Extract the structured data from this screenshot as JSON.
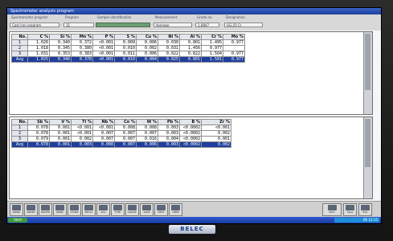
{
  "window": {
    "title": "Spectrometer analysis program"
  },
  "infobar": [
    {
      "text": "Spectrometer program",
      "kind": "lab"
    },
    {
      "text": "Program",
      "kind": "lab"
    },
    {
      "text": "Sample identification",
      "kind": "lab"
    },
    {
      "text": "Measurement",
      "kind": "lab"
    },
    {
      "text": "Grade no.",
      "kind": "lab"
    },
    {
      "text": "Designation",
      "kind": "lab"
    },
    {
      "text": "Cast iron program",
      "kind": "box"
    },
    {
      "text": "11",
      "kind": "box"
    },
    {
      "text": "",
      "kind": "green"
    },
    {
      "text": "Average",
      "kind": "box"
    },
    {
      "text": "1.0847",
      "kind": "box"
    },
    {
      "text": "GG-25 Cr",
      "kind": "box"
    }
  ],
  "table1": {
    "headers": [
      "No.",
      "C %",
      "Si %",
      "Mn %",
      "P %",
      "S %",
      "Cu %",
      "Ni %",
      "Al %",
      "Cr %",
      "Mo %"
    ],
    "rows": [
      [
        "1",
        "1.026",
        "0.340",
        "0.372",
        "<0.001",
        "0.009",
        "0.006",
        "0.030",
        "0.801",
        "1.495",
        "0.977"
      ],
      [
        "2",
        "1.018",
        "0.345",
        "0.380",
        "<0.001",
        "0.010",
        "0.002",
        "0.031",
        "1.456",
        "0.977"
      ],
      [
        "3",
        "1.031",
        "0.353",
        "0.383",
        "<0.001",
        "0.011",
        "0.006",
        "0.022",
        "0.822",
        "1.504",
        "0.977"
      ]
    ],
    "average": [
      "Avg",
      "1.025",
      "0.346",
      "0.378",
      "<0.001",
      "0.010",
      "0.004",
      "0.025",
      "0.801",
      "1.501",
      "0.977"
    ]
  },
  "table2": {
    "headers": [
      "No.",
      "Sb %",
      "V %",
      "Ti %",
      "Nb %",
      "Co %",
      "W %",
      "Pb %",
      "B %",
      "Zr %"
    ],
    "rows": [
      [
        "1",
        "0.078",
        "0.001",
        "<0.001",
        "<0.001",
        "0.008",
        "0.008",
        "0.003",
        "<0.0002",
        "<0.001"
      ],
      [
        "2",
        "0.078",
        "0.001",
        "<0.001",
        "0.007",
        "0.007",
        "0.007",
        "0.003",
        "<0.0002",
        "0.002"
      ],
      [
        "3",
        "0.079",
        "0.001",
        "0.002",
        "0.007",
        "0.007",
        "0.016",
        "0.004",
        "<0.0002",
        "0.001"
      ]
    ],
    "average": [
      "Avg",
      "0.078",
      "0.001",
      "0.003",
      "0.008",
      "0.007",
      "0.006",
      "0.003",
      "<0.0002",
      "0.002"
    ]
  },
  "toolbar": {
    "left": [
      "SPARK",
      "ABORT",
      "DELETE",
      "PRINT",
      "STORE",
      "RECAL",
      "AVG",
      "TYPE",
      "GRADE",
      "SAVE",
      "NEXT",
      "OPEN"
    ],
    "right": [
      "Start",
      "Save",
      "Exit"
    ]
  },
  "taskbar": {
    "start": "Start",
    "tray": "DE  12:15"
  },
  "brand": "BELEC"
}
